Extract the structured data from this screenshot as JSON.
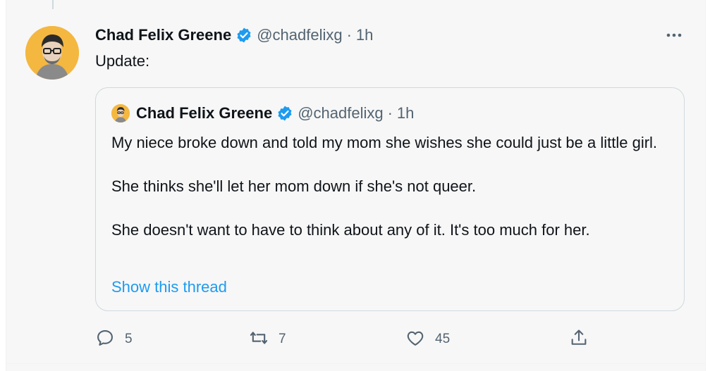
{
  "tweet": {
    "author_name": "Chad Felix Greene",
    "handle": "@chadfelixg",
    "separator": "·",
    "time": "1h",
    "text": "Update:"
  },
  "quoted": {
    "author_name": "Chad Felix Greene",
    "handle": "@chadfelixg",
    "separator": "·",
    "time": "1h",
    "paragraphs": [
      "My niece broke down and told my mom she wishes she could just be a little girl.",
      "She thinks she'll let her mom down if she's not queer.",
      "She doesn't want to have to think about any of it. It's too much for her."
    ],
    "show_thread": "Show this thread"
  },
  "actions": {
    "replies": "5",
    "retweets": "7",
    "likes": "45"
  },
  "icons": {
    "verified": "verified-badge-icon",
    "more": "more-icon",
    "reply": "reply-icon",
    "retweet": "retweet-icon",
    "like": "heart-icon",
    "share": "share-icon"
  },
  "colors": {
    "accent": "#1d9bf0",
    "secondary_text": "#536471",
    "avatar_bg": "#f4b740"
  }
}
